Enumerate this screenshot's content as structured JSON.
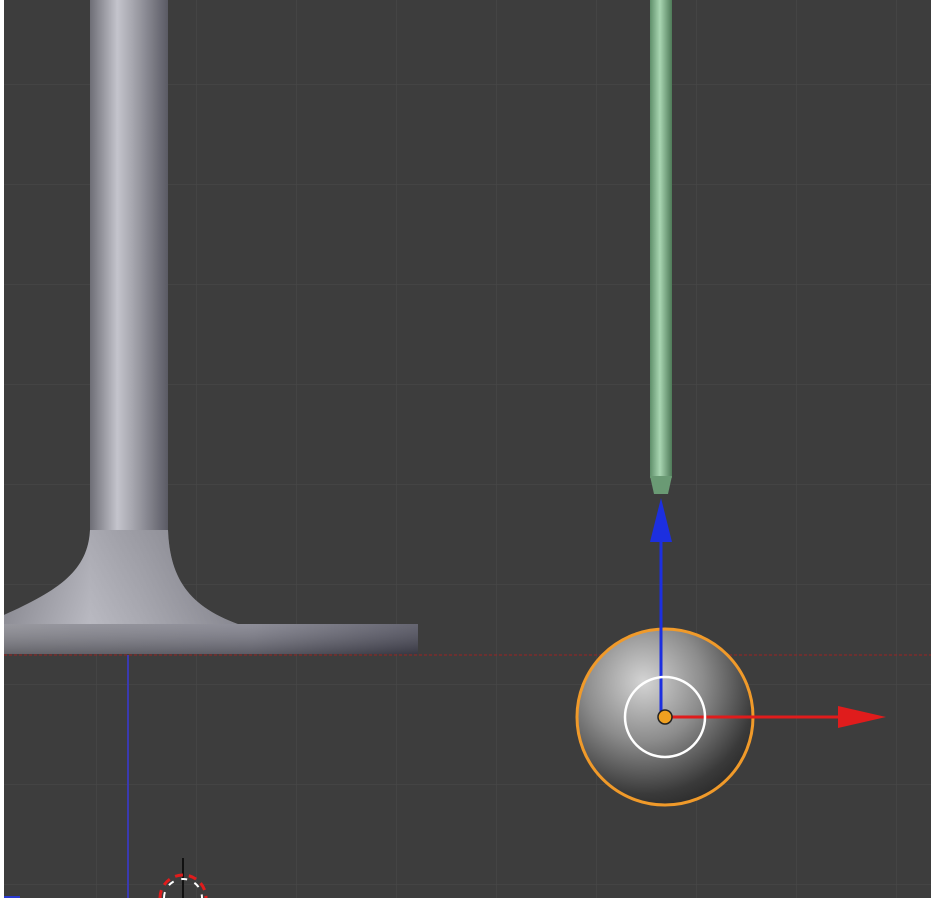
{
  "viewport": {
    "background": "#3d3d3d",
    "grid_color": "#444444",
    "frame_color": "#ffffff"
  },
  "scene": {
    "objects": [
      {
        "name": "valve-stem-mesh",
        "type": "mesh",
        "selected": false,
        "color": "#9a9aa2"
      },
      {
        "name": "green-rod-mesh",
        "type": "mesh",
        "selected": false,
        "color": "#8fc09a"
      },
      {
        "name": "sphere-object",
        "type": "mesh",
        "selected": true,
        "color": "#8a8a8a",
        "outline_color": "#f09a2a"
      }
    ],
    "axes": {
      "x_color": "#e01c1c",
      "y_color": "#5aaa4a",
      "z_color": "#1c2fe0"
    },
    "gizmo": {
      "type": "translate",
      "arrows": [
        "x-arrow",
        "z-arrow"
      ],
      "center_ring": "view-align-ring",
      "origin_color": "#f0a020"
    },
    "cursor_3d": {
      "visible": true,
      "ring_colors": [
        "#e01c1c",
        "#ffffff"
      ]
    }
  }
}
